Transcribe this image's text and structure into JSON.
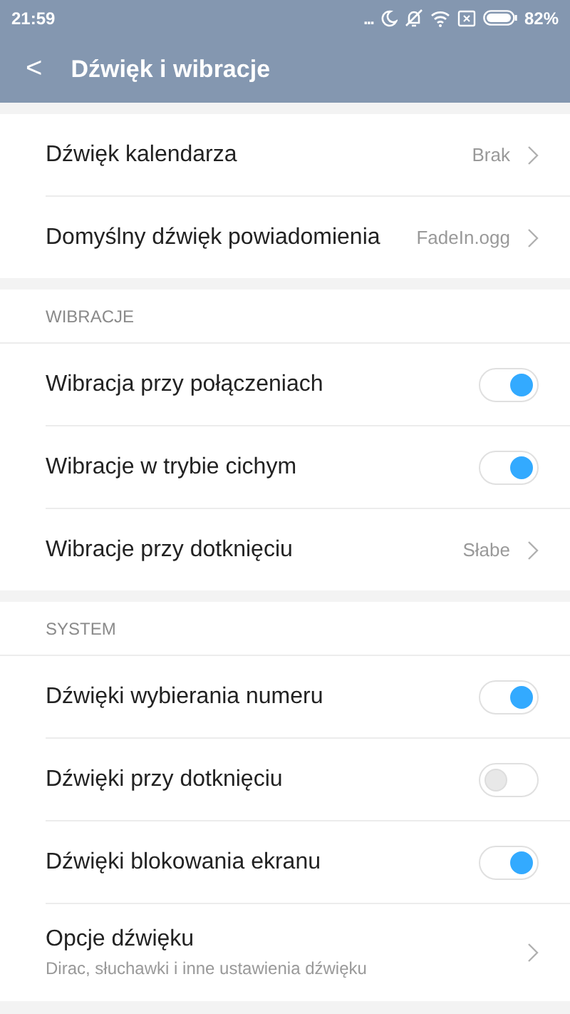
{
  "status_bar": {
    "time": "21:59",
    "dots": "...",
    "battery": "82%"
  },
  "header": {
    "back": "<",
    "title": "Dźwięk i wibracje"
  },
  "sections": [
    {
      "rows": [
        {
          "kind": "link",
          "label": "Dźwięk kalendarza",
          "value": "Brak"
        },
        {
          "kind": "link",
          "label": "Domyślny dźwięk powiadomienia",
          "value": "FadeIn.ogg"
        }
      ]
    },
    {
      "title": "WIBRACJE",
      "rows": [
        {
          "kind": "toggle",
          "label": "Wibracja przy połączeniach",
          "on": true
        },
        {
          "kind": "toggle",
          "label": "Wibracje w trybie cichym",
          "on": true
        },
        {
          "kind": "link",
          "label": "Wibracje przy dotknięciu",
          "value": "Słabe"
        }
      ]
    },
    {
      "title": "SYSTEM",
      "rows": [
        {
          "kind": "toggle",
          "label": "Dźwięki wybierania numeru",
          "on": true
        },
        {
          "kind": "toggle",
          "label": "Dźwięki przy dotknięciu",
          "on": false
        },
        {
          "kind": "toggle",
          "label": "Dźwięki blokowania ekranu",
          "on": true
        },
        {
          "kind": "link",
          "label": "Opcje dźwięku",
          "subtitle": "Dirac, słuchawki i inne ustawienia dźwięku"
        }
      ]
    }
  ]
}
